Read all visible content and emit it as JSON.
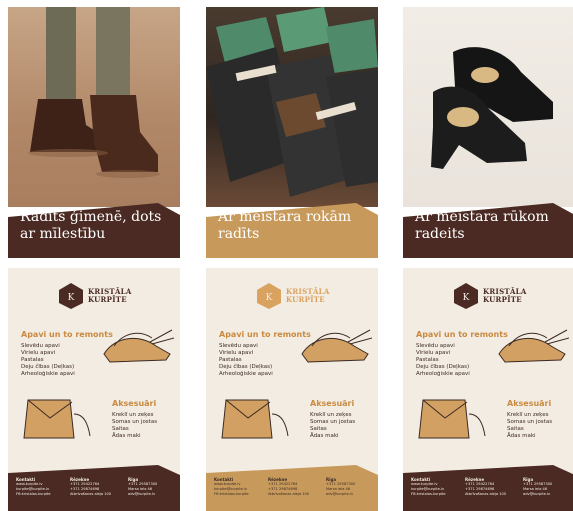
{
  "colors": {
    "dark_brown": "#4a2a22",
    "tan": "#c79a5c",
    "cream": "#f3ece3",
    "accent": "#c98a3f"
  },
  "ads": [
    {
      "text": "Radīts ģimenē, dots ar mīlestību",
      "banner_color": "#4a2a22"
    },
    {
      "text": "Ar meistara rokām radīts",
      "banner_color": "#c79a5c"
    },
    {
      "text": "Ar meistara rūkom radeits",
      "banner_color": "#4a2a22"
    }
  ],
  "posters": [
    {
      "brand": "KRISTĀLA KURPĪTE",
      "section1_title": "Apavi un to remonts",
      "section1_items": [
        "Slevēdu apavi",
        "Virielu apavi",
        "Pastalas",
        "Deju čības (Deļkas)",
        "Arheoloģiskie apavi"
      ],
      "section2_title": "Aksesuāri",
      "section2_items": [
        "Kreklī un zeķes",
        "Somas un jostas",
        "Saitas",
        "Ādas maki"
      ],
      "footer_color": "#4a2a22",
      "footer": [
        {
          "title": "Kontakti",
          "lines": [
            "www.kurpite.lv",
            "kurpite@kurpite.lv",
            "FB:kristalas.kurpite"
          ]
        },
        {
          "title": "Rēzekne",
          "lines": [
            "+371 29422764",
            "+371 29874698",
            "Atbrīvošanas aleja 100"
          ]
        },
        {
          "title": "Rīga",
          "lines": [
            "+371 29587300",
            "Marsa iela 46",
            "adv@kurpite.lv"
          ]
        }
      ]
    },
    {
      "brand": "KRISTĀLA KURPĪTE",
      "section1_title": "Apavi un to remonts",
      "section1_items": [
        "Slevēdu apavi",
        "Virielu apavi",
        "Pastalas",
        "Deju čības (Deļkas)",
        "Arheoloģiskie apavi"
      ],
      "section2_title": "Aksesuāri",
      "section2_items": [
        "Kreklī un zeķes",
        "Somas un jostas",
        "Saitas",
        "Ādas maki"
      ],
      "footer_color": "#c79a5c",
      "footer": [
        {
          "title": "Kontakti",
          "lines": [
            "www.kurpite.lv",
            "kurpite@kurpite.lv",
            "FB:kristalas.kurpite"
          ]
        },
        {
          "title": "Rēzekne",
          "lines": [
            "+371 29422764",
            "+371 29874698",
            "Atbrīvošanas aleja 100"
          ]
        },
        {
          "title": "Rīga",
          "lines": [
            "+371 29587300",
            "Marsa iela 46",
            "adv@kurpite.lv"
          ]
        }
      ]
    },
    {
      "brand": "KRISTĀLA KURPĪTE",
      "section1_title": "Apavi un to remonts",
      "section1_items": [
        "Slevēdu apavi",
        "Virielu apavi",
        "Pastalas",
        "Deju čības (Deļkas)",
        "Arheoloģiskie apavi"
      ],
      "section2_title": "Aksesuāri",
      "section2_items": [
        "Kreklī un zeķes",
        "Somas un jostas",
        "Saitas",
        "Ādas maki"
      ],
      "footer_color": "#4a2a22",
      "footer": [
        {
          "title": "Kontakti",
          "lines": [
            "www.kurpite.lv",
            "kurpite@kurpite.lv",
            "FB:kristalas.kurpite"
          ]
        },
        {
          "title": "Rēzekne",
          "lines": [
            "+371 29422764",
            "+371 29874698",
            "Atbrīvošanas aleja 100"
          ]
        },
        {
          "title": "Rīga",
          "lines": [
            "+371 29587300",
            "Marsa iela 46",
            "adv@kurpite.lv"
          ]
        }
      ]
    }
  ]
}
